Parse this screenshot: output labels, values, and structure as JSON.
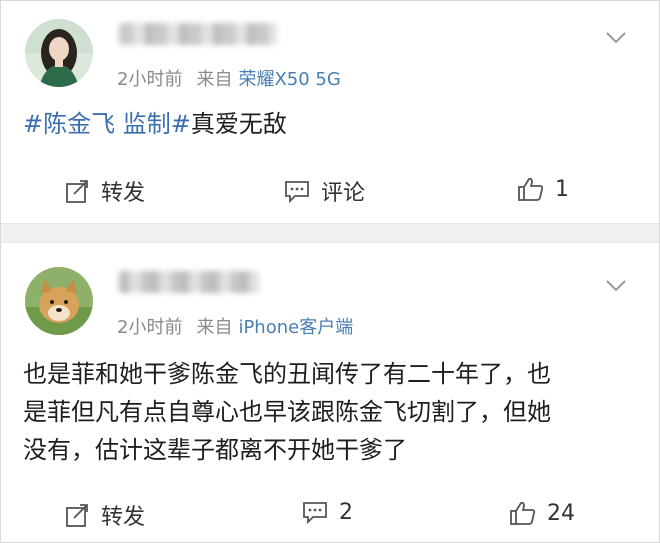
{
  "posts": [
    {
      "time": "2小时前",
      "from_label": "来自",
      "device": "荣耀X50 5G",
      "content": {
        "tag1": "#陈金飞 监制#",
        "text": "真爱无敌"
      },
      "actions": {
        "repost_label": "转发",
        "comment_label": "评论",
        "like_count": "1"
      }
    },
    {
      "time": "2小时前",
      "from_label": "来自",
      "device": "iPhone客户端",
      "content": {
        "line1": "也是菲和她干爹陈金飞的丑闻传了有二十年了，也",
        "line2": "是菲但凡有点自尊心也早该跟陈金飞切割了，但她",
        "line3": "没有，估计这辈子都离不开她干爹了"
      },
      "actions": {
        "repost_label": "转发",
        "comment_count": "2",
        "like_count": "24"
      }
    }
  ],
  "colors": {
    "accent_link": "#3b6fb0",
    "meta_gray": "#8a8a8a",
    "separator": "#f0f0f0"
  },
  "icons": {
    "repost": "repost-icon",
    "comment": "comment-icon",
    "like": "thumbs-up-icon",
    "menu": "chevron-down-icon"
  }
}
